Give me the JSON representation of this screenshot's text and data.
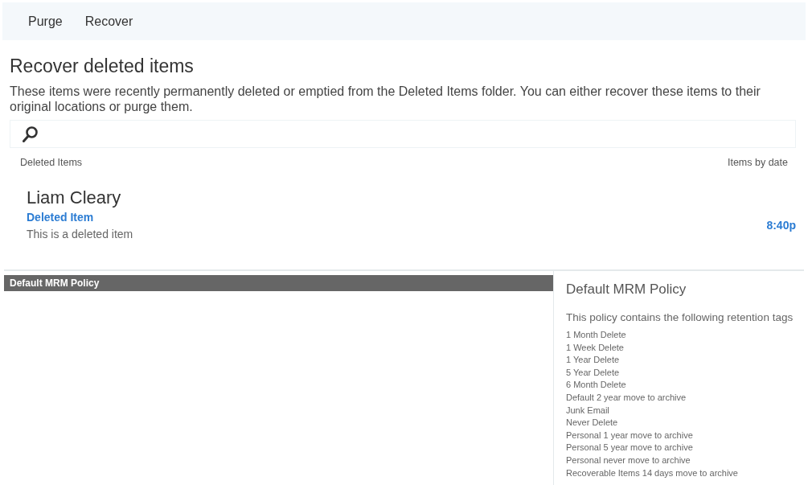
{
  "toolbar": {
    "buttons": [
      "Purge",
      "Recover"
    ]
  },
  "page": {
    "title": "Recover deleted items",
    "description": "These items were recently permanently deleted or emptied from the Deleted Items folder. You can either recover these items to their original locations or purge them."
  },
  "list": {
    "header_left": "Deleted Items",
    "header_right": "Items by date",
    "items": [
      {
        "sender": "Liam Cleary",
        "subject": "Deleted Item",
        "preview": "This is a deleted item",
        "time": "8:40p"
      }
    ]
  },
  "policies": {
    "items": [
      {
        "name": "Default MRM Policy",
        "selected": true
      }
    ]
  },
  "details": {
    "title": "Default MRM Policy",
    "intro": "This policy contains the following retention tags",
    "tags": [
      "1 Month Delete",
      "1 Week Delete",
      "1 Year Delete",
      "5 Year Delete",
      "6 Month Delete",
      "Default 2 year move to archive",
      "Junk Email",
      "Never Delete",
      "Personal 1 year move to archive",
      "Personal 5 year move to archive",
      "Personal never move to archive",
      "Recoverable Items 14 days move to archive"
    ]
  }
}
